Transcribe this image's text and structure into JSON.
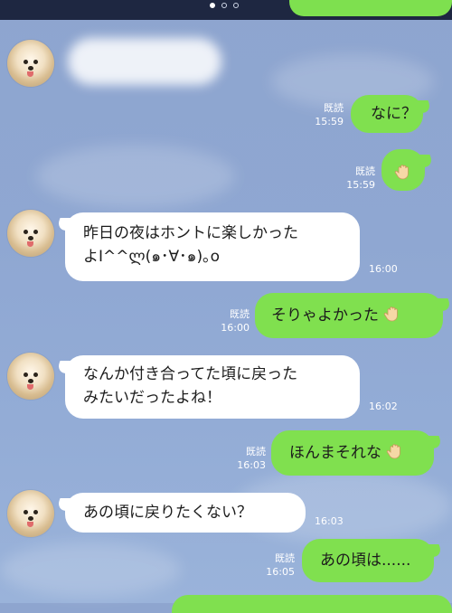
{
  "pager": {
    "active_index": 0,
    "count": 3
  },
  "contact": {
    "name_hidden": true
  },
  "messages": [
    {
      "id": "m1",
      "side": "out",
      "text": "なに？",
      "read_label": "既読",
      "time": "15:59"
    },
    {
      "id": "m2",
      "side": "out",
      "icon": "raised-hand-emoji",
      "text": "",
      "read_label": "既読",
      "time": "15:59"
    },
    {
      "id": "m3",
      "side": "in",
      "line1": "昨日の夜はホントに楽しかった",
      "line2": "よI^^ლ(๑･∀･๑)｡o",
      "time": "16:00"
    },
    {
      "id": "m4",
      "side": "out",
      "text": "そりゃよかった",
      "icon": "raised-hand-emoji",
      "read_label": "既読",
      "time": "16:00"
    },
    {
      "id": "m5",
      "side": "in",
      "line1": "なんか付き合ってた頃に戻った",
      "line2": "みたいだったよね！",
      "time": "16:02"
    },
    {
      "id": "m6",
      "side": "out",
      "text": "ほんまそれな",
      "icon": "raised-hand-emoji",
      "read_label": "既読",
      "time": "16:03"
    },
    {
      "id": "m7",
      "side": "in",
      "text": "あの頃に戻りたくない？",
      "time": "16:03"
    },
    {
      "id": "m8",
      "side": "out",
      "text": "あの頃は......",
      "read_label": "既読",
      "time": "16:05"
    }
  ],
  "colors": {
    "outgoing_bubble": "#80e04f",
    "incoming_bubble": "#ffffff",
    "background": "#8fa7d2",
    "top_bar": "#1e2741"
  }
}
